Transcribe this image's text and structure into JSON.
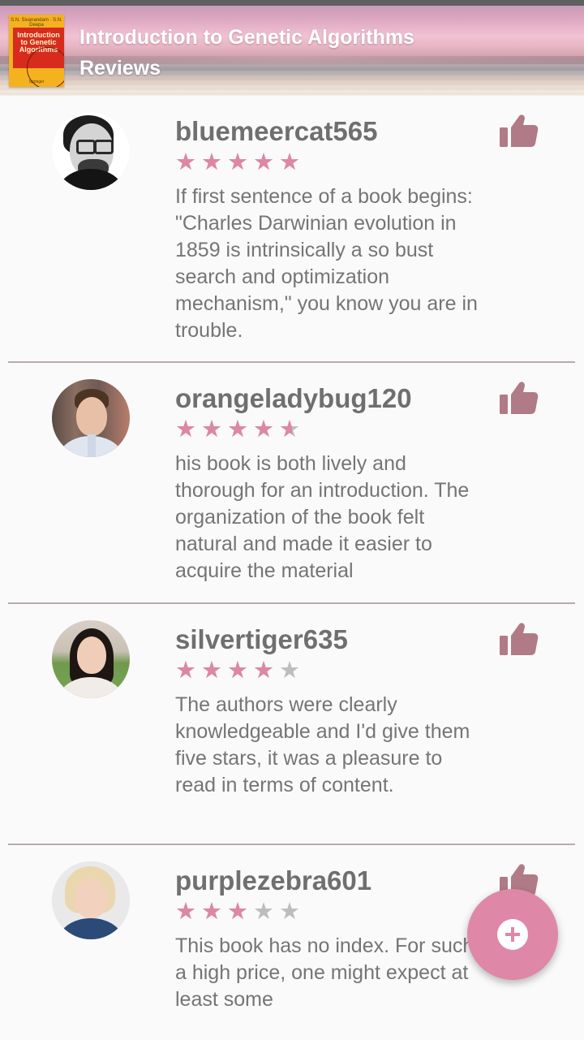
{
  "header": {
    "title_line1": "Introduction to Genetic Algorithms",
    "title_line2": "Reviews",
    "cover": {
      "authors": "S.N. Sivanandam · S.N. Deepa",
      "title": "Introduction to Genetic Algorithms",
      "publisher": "Springer"
    }
  },
  "colors": {
    "accent": "#de87a6",
    "star_filled": "#dd86a5",
    "star_empty": "#bdbdbd",
    "thumb": "#b07b86",
    "text": "#757575",
    "username": "#6f6f6f"
  },
  "reviews": [
    {
      "username": "bluemeercat565",
      "rating": 5,
      "text": "If first sentence of a book begins: \"Charles Darwinian evolution in 1859 is intrinsically a so bust search and optimization mechanism,\" you know you are in trouble.",
      "like_icon": "thumbs-up-icon"
    },
    {
      "username": "orangeladybug120",
      "rating": 4.5,
      "text": "his book is both lively and thorough for an introduction. The organization of the book felt natural and made it easier to acquire the material",
      "like_icon": "thumbs-up-icon"
    },
    {
      "username": "silvertiger635",
      "rating": 4,
      "text": "The authors were clearly knowledgeable and I'd give them five stars, it was a pleasure to read in terms of content.",
      "like_icon": "thumbs-up-icon"
    },
    {
      "username": "purplezebra601",
      "rating": 3,
      "text": "This book has no index. For such a high price, one might expect at least some",
      "like_icon": "thumbs-up-icon"
    }
  ],
  "fab": {
    "icon": "add-icon"
  }
}
